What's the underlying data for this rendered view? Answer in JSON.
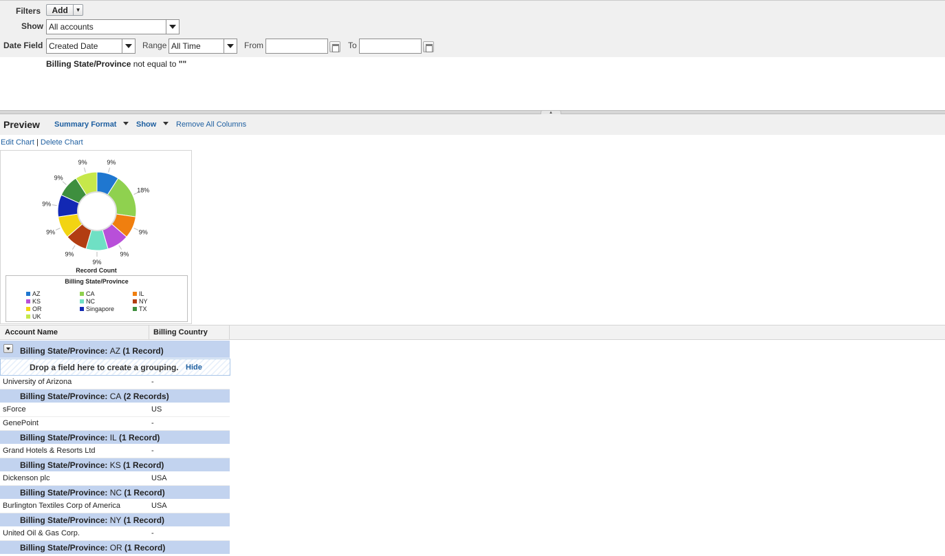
{
  "filters": {
    "filters_label": "Filters",
    "add_label": "Add",
    "show_label": "Show",
    "show_value": "All accounts",
    "date_field_label": "Date Field",
    "date_field_value": "Created Date",
    "range_label": "Range",
    "range_value": "All Time",
    "from_label": "From",
    "from_value": "",
    "to_label": "To",
    "to_value": "",
    "criteria": {
      "field": "Billing State/Province",
      "operator": " not equal to ",
      "value": "\"\""
    }
  },
  "preview": {
    "title": "Preview",
    "summary_format": "Summary Format",
    "show": "Show",
    "remove_all_columns": "Remove All Columns",
    "edit_chart": "Edit Chart",
    "delete_chart": "Delete Chart"
  },
  "chart_data": {
    "type": "pie",
    "donut": true,
    "title": "Record Count",
    "legend_title": "Billing State/Province",
    "legend_placement": "bottom",
    "categories": [
      "AZ",
      "CA",
      "IL",
      "KS",
      "NC",
      "NY",
      "OR",
      "Singapore",
      "TX",
      "UK"
    ],
    "values": [
      1,
      2,
      1,
      1,
      1,
      1,
      1,
      1,
      1,
      1
    ],
    "labels": [
      "9%",
      "18%",
      "9%",
      "9%",
      "9%",
      "9%",
      "9%",
      "9%",
      "9%",
      "9%"
    ],
    "colors": [
      "#1f77d0",
      "#8fd14f",
      "#f07f0f",
      "#b84fd9",
      "#6fe0c4",
      "#b23d12",
      "#f2d412",
      "#1228b4",
      "#3e8f3e",
      "#c6e84a"
    ]
  },
  "table": {
    "columns": [
      "Account Name",
      "Billing Country"
    ],
    "drop_zone_text": "Drop a field here to create a grouping.",
    "drop_zone_hide": "Hide",
    "groups": [
      {
        "field": "Billing State/Province: ",
        "value": "AZ",
        "count": " (1 Record)",
        "rows": [
          [
            "University of Arizona",
            "-"
          ]
        ]
      },
      {
        "field": "Billing State/Province: ",
        "value": "CA",
        "count": " (2 Records)",
        "rows": [
          [
            "sForce",
            "US"
          ],
          [
            "GenePoint",
            "-"
          ]
        ]
      },
      {
        "field": "Billing State/Province: ",
        "value": "IL",
        "count": " (1 Record)",
        "rows": [
          [
            "Grand Hotels & Resorts Ltd",
            "-"
          ]
        ]
      },
      {
        "field": "Billing State/Province: ",
        "value": "KS",
        "count": " (1 Record)",
        "rows": [
          [
            "Dickenson plc",
            "USA"
          ]
        ]
      },
      {
        "field": "Billing State/Province: ",
        "value": "NC",
        "count": " (1 Record)",
        "rows": [
          [
            "Burlington Textiles Corp of America",
            "USA"
          ]
        ]
      },
      {
        "field": "Billing State/Province: ",
        "value": "NY",
        "count": " (1 Record)",
        "rows": [
          [
            "United Oil & Gas Corp.",
            "-"
          ]
        ]
      },
      {
        "field": "Billing State/Province: ",
        "value": "OR",
        "count": " (1 Record)",
        "rows": []
      }
    ]
  }
}
